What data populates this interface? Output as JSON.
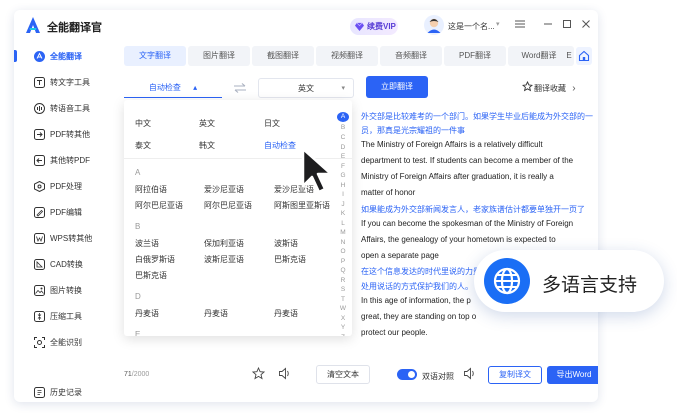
{
  "app": {
    "title": "全能翻译官"
  },
  "header": {
    "vip_label": "续费VIP",
    "user_name": "这是一个名...",
    "user_caret": "▾"
  },
  "sidebar": {
    "items": [
      {
        "label": "全能翻译",
        "icon": "translate-icon",
        "active": true
      },
      {
        "label": "转文字工具",
        "icon": "text-tool-icon"
      },
      {
        "label": "转语音工具",
        "icon": "speech-tool-icon"
      },
      {
        "label": "PDF转其他",
        "icon": "pdf-convert-icon"
      },
      {
        "label": "其他转PDF",
        "icon": "to-pdf-icon"
      },
      {
        "label": "PDF处理",
        "icon": "pdf-process-icon"
      },
      {
        "label": "PDF编辑",
        "icon": "pdf-edit-icon"
      },
      {
        "label": "WPS转其他",
        "icon": "wps-icon"
      },
      {
        "label": "CAD转换",
        "icon": "cad-icon"
      },
      {
        "label": "图片转换",
        "icon": "image-icon"
      },
      {
        "label": "压缩工具",
        "icon": "compress-icon"
      },
      {
        "label": "全能识别",
        "icon": "scan-icon"
      },
      {
        "label": "历史记录",
        "icon": "history-icon"
      }
    ]
  },
  "tabs": [
    {
      "label": "文字翻译",
      "active": true
    },
    {
      "label": "图片翻译"
    },
    {
      "label": "截图翻译"
    },
    {
      "label": "视频翻译"
    },
    {
      "label": "音频翻译"
    },
    {
      "label": "PDF翻译"
    },
    {
      "label": "Word翻译"
    },
    {
      "label": "E"
    }
  ],
  "toolbar": {
    "source_lang": "自动检查",
    "source_caret": "▴",
    "target_lang": "英文",
    "target_caret": "▾",
    "translate_button": "立即翻译",
    "collect_label": "翻译收藏",
    "collect_chevron": "›"
  },
  "dropdown": {
    "top_rows": [
      [
        "中文",
        "英文",
        "日文"
      ],
      [
        "泰文",
        "韩文",
        "自动检查"
      ]
    ],
    "sections": [
      {
        "letter": "A",
        "rows": [
          [
            "阿拉伯语",
            "爱沙尼亚语",
            "爱沙尼亚语"
          ],
          [
            "阿尔巴尼亚语",
            "阿尔巴尼亚语",
            "阿斯图里亚斯语"
          ]
        ]
      },
      {
        "letter": "B",
        "rows": [
          [
            "波兰语",
            "保加利亚语",
            "波斯语"
          ],
          [
            "白俄罗斯语",
            "波斯尼亚语",
            "巴斯克语"
          ],
          [
            "巴斯克语",
            "",
            ""
          ]
        ]
      },
      {
        "letter": "D",
        "rows": [
          [
            "丹麦语",
            "丹麦语",
            "丹麦语"
          ]
        ]
      },
      {
        "letter": "E",
        "rows": []
      }
    ],
    "alphabet": [
      "A",
      "B",
      "C",
      "D",
      "E",
      "F",
      "G",
      "H",
      "I",
      "J",
      "K",
      "L",
      "M",
      "N",
      "O",
      "P",
      "Q",
      "R",
      "S",
      "T",
      "W",
      "X",
      "Y",
      "Z"
    ]
  },
  "output": {
    "lines": [
      {
        "text": "外交部是比较难考的一个部门。如果学生毕业后能成为外交部的一",
        "lang": "cn"
      },
      {
        "text": "员，那真是光宗耀祖的一件事",
        "lang": "cn"
      },
      {
        "text": "The Ministry of Foreign Affairs is a relatively difficult",
        "lang": "en"
      },
      {
        "text": "department to test. If students can become a member of the",
        "lang": "en"
      },
      {
        "text": "Ministry of Foreign Affairs after graduation, it is really a",
        "lang": "en"
      },
      {
        "text": "matter of honor",
        "lang": "en"
      },
      {
        "text": "如果能成为外交部新闻发言人，老家族谱估计都要单独开一页了",
        "lang": "cn"
      },
      {
        "text": "If you can become the spokesman of the Ministry of Foreign",
        "lang": "en"
      },
      {
        "text": "Affairs, the genealogy of your hometown is expected to",
        "lang": "en"
      },
      {
        "text": "open a separate page",
        "lang": "en"
      },
      {
        "text": "在这个信息发达的时代里说的力量是",
        "lang": "cn"
      },
      {
        "text": "处用说话的方式保护我们的人。",
        "lang": "cn"
      },
      {
        "text": "In this age of information, the p",
        "lang": "en"
      },
      {
        "text": "great, they are standing on top o",
        "lang": "en"
      },
      {
        "text": "protect our people.",
        "lang": "en"
      }
    ]
  },
  "badge": {
    "text": "多语言支持"
  },
  "bottom": {
    "count": "71",
    "limit": "/2000",
    "clear_label": "清空文本",
    "bilingual_label": "双语对照",
    "copy_label": "复制译文",
    "export_label": "导出Word"
  },
  "colors": {
    "accent": "#2b63f5",
    "badge_globe": "#1a6ef5"
  }
}
